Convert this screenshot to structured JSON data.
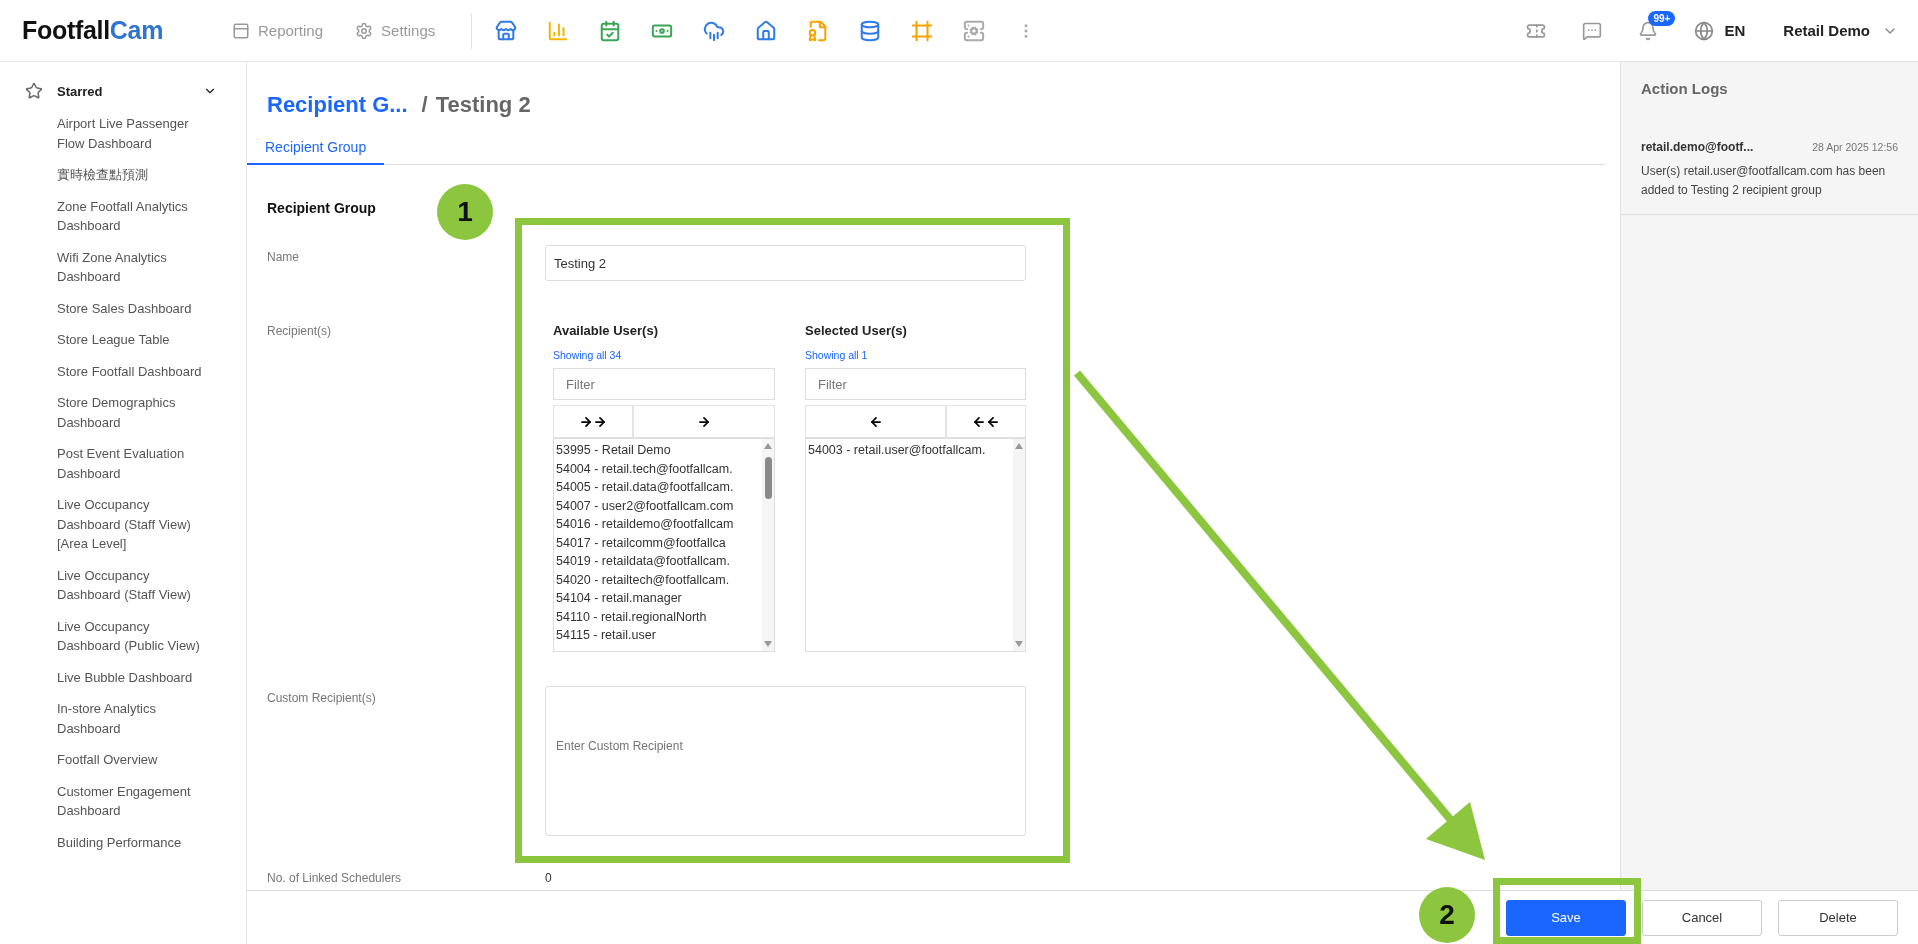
{
  "header": {
    "logo": {
      "dark_part": "Footfall",
      "blue_part": "Cam"
    },
    "nav": [
      {
        "label": "Reporting",
        "kind": "reports"
      },
      {
        "label": "Settings",
        "kind": "settings"
      }
    ],
    "notifications_badge": "99+",
    "language": "EN",
    "user": "Retail Demo"
  },
  "sidebar": {
    "section": {
      "label": "Starred",
      "expanded": true
    },
    "items": [
      "Airport Live Passenger Flow Dashboard",
      "實時檢查點預測",
      "Zone Footfall Analytics Dashboard",
      "Wifi Zone Analytics Dashboard",
      "Store Sales Dashboard",
      "Store League Table",
      "Store Footfall Dashboard",
      "Store Demographics Dashboard",
      "Post Event Evaluation Dashboard",
      "Live Occupancy Dashboard (Staff View) [Area Level]",
      "Live Occupancy Dashboard (Staff View)",
      "Live Occupancy Dashboard (Public View)",
      "Live Bubble Dashboard",
      "In-store Analytics Dashboard",
      "Footfall Overview",
      "Customer Engagement Dashboard",
      "Building Performance"
    ]
  },
  "breadcrumb": {
    "parent": "Recipient G...",
    "separator": "/",
    "current": "Testing 2"
  },
  "tabs": [
    {
      "label": "Recipient Group",
      "selected": true
    }
  ],
  "form": {
    "heading": "Recipient Group",
    "name": {
      "label": "Name",
      "value": "Testing 2"
    },
    "recipients": {
      "label": "Recipient(s)",
      "available": {
        "title": "Available User(s)",
        "count_text": "Showing all 34",
        "filter_placeholder": "Filter",
        "items": [
          "53995 - Retail Demo",
          "54004 - retail.tech@footfallcam.",
          "54005 - retail.data@footfallcam.",
          "54007 - user2@footfallcam.com",
          "54016 - retaildemo@footfallcam",
          "54017 - retailcomm@footfallca",
          "54019 - retaildata@footfallcam.",
          "54020 - retailtech@footfallcam.",
          "54104 - retail.manager",
          "54110 - retail.regionalNorth",
          "54115 - retail.user"
        ]
      },
      "selected": {
        "title": "Selected User(s)",
        "count_text": "Showing all 1",
        "filter_placeholder": "Filter",
        "items": [
          "54003 - retail.user@footfallcam."
        ]
      }
    },
    "custom": {
      "label": "Custom Recipient(s)",
      "placeholder": "Enter Custom Recipient"
    },
    "linked": {
      "label": "No. of Linked Schedulers",
      "value": "0"
    }
  },
  "action_logs": {
    "title": "Action Logs",
    "entries": [
      {
        "user": "retail.demo@footf...",
        "time": "28 Apr 2025 12:56",
        "message": "User(s) retail.user@footfallcam.com has been added to Testing 2 recipient group"
      }
    ]
  },
  "footer": {
    "buttons": [
      {
        "label": "Save",
        "kind": "primary"
      },
      {
        "label": "Cancel",
        "kind": "default"
      },
      {
        "label": "Delete",
        "kind": "default"
      }
    ]
  },
  "annotations": [
    {
      "label": "1"
    },
    {
      "label": "2"
    }
  ]
}
